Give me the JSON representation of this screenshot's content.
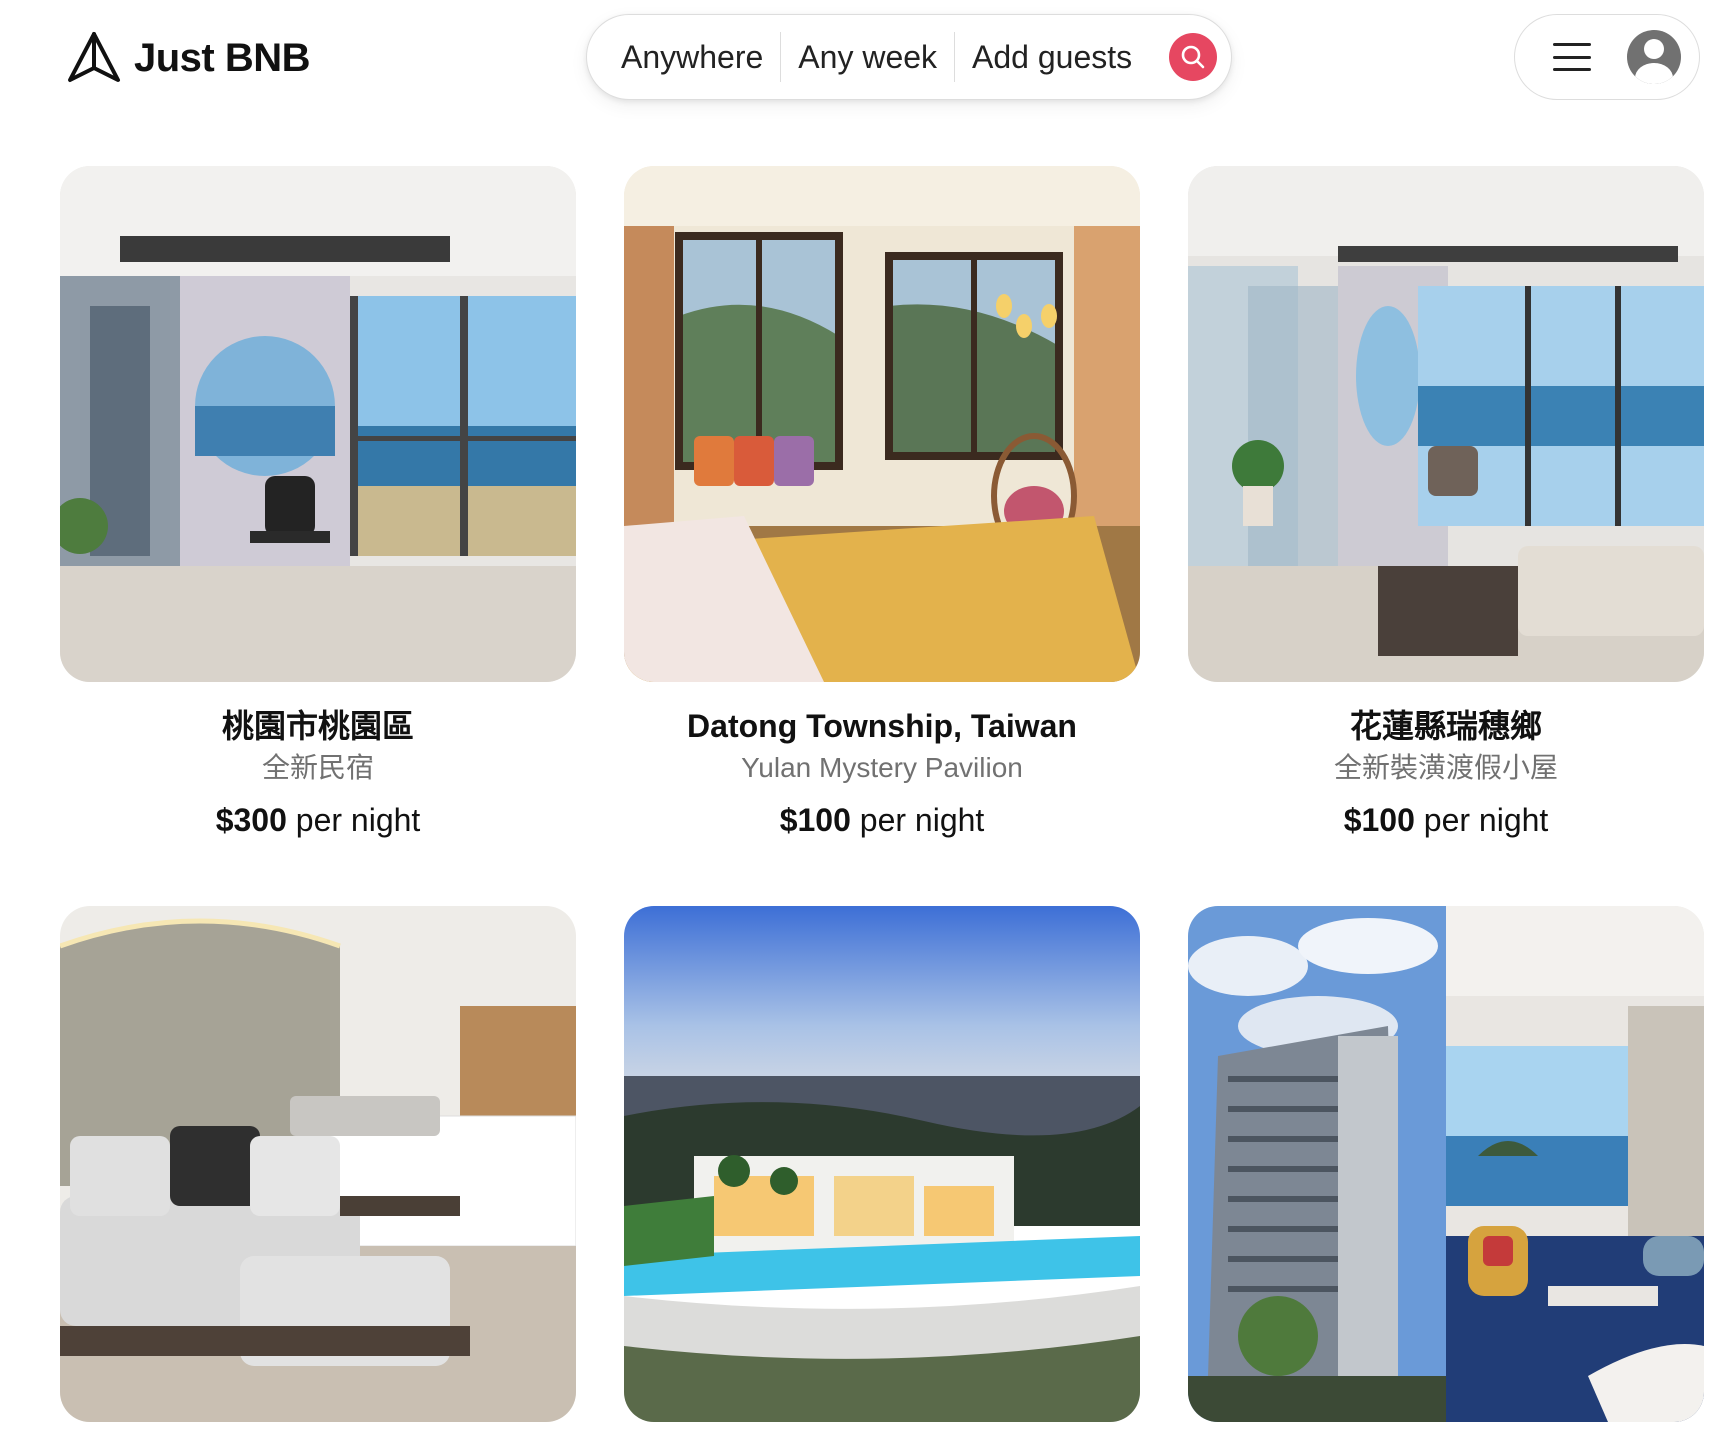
{
  "brand": {
    "name": "Just BNB",
    "logo_icon": "paper-plane-icon"
  },
  "search": {
    "location": "Anywhere",
    "dates": "Any week",
    "guests": "Add guests",
    "button_icon": "search-icon",
    "accent_color": "#e64761"
  },
  "user_menu": {
    "menu_icon": "hamburger-icon",
    "avatar_icon": "user-avatar-icon"
  },
  "listings": [
    {
      "title": "桃園市桃園區",
      "subtitle": "全新民宿",
      "price": "$300",
      "price_suffix": "per night",
      "photo": "ocean-view bedroom with balcony"
    },
    {
      "title": "Datong Township, Taiwan",
      "subtitle": "Yulan Mystery Pavilion",
      "price": "$100",
      "price_suffix": "per night",
      "photo": "mountain-view bedroom with hanging chair"
    },
    {
      "title": "花蓮縣瑞穗鄉",
      "subtitle": "全新裝潢渡假小屋",
      "price": "$100",
      "price_suffix": "per night",
      "photo": "ocean-view living room with glass shower"
    },
    {
      "title": "",
      "subtitle": "",
      "price": "",
      "price_suffix": "",
      "photo": "modern bedroom with sectional sofa"
    },
    {
      "title": "",
      "subtitle": "",
      "price": "",
      "price_suffix": "",
      "photo": "aerial view of luxury villa at dusk"
    },
    {
      "title": "",
      "subtitle": "",
      "price": "",
      "price_suffix": "",
      "photo": "hotel tower and ocean-view suite"
    }
  ]
}
